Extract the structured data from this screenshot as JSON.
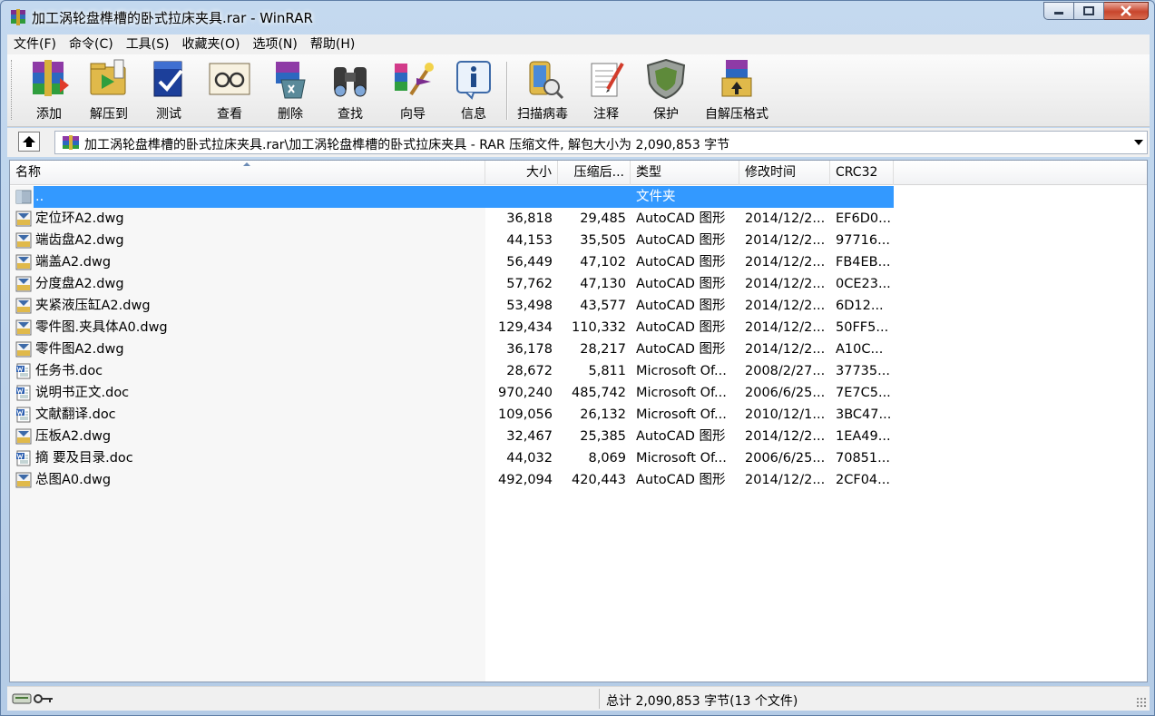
{
  "window": {
    "title": "加工涡轮盘榫槽的卧式拉床夹具.rar - WinRAR"
  },
  "menu": [
    {
      "label": "文件(F)"
    },
    {
      "label": "命令(C)"
    },
    {
      "label": "工具(S)"
    },
    {
      "label": "收藏夹(O)"
    },
    {
      "label": "选项(N)"
    },
    {
      "label": "帮助(H)"
    }
  ],
  "toolbar": [
    {
      "label": "添加",
      "icon": "add-archive-icon"
    },
    {
      "label": "解压到",
      "icon": "extract-to-icon"
    },
    {
      "label": "测试",
      "icon": "test-icon"
    },
    {
      "label": "查看",
      "icon": "view-icon"
    },
    {
      "label": "删除",
      "icon": "delete-icon"
    },
    {
      "label": "查找",
      "icon": "find-icon"
    },
    {
      "label": "向导",
      "icon": "wizard-icon"
    },
    {
      "label": "信息",
      "icon": "info-icon"
    },
    {
      "label": "扫描病毒",
      "icon": "virus-scan-icon"
    },
    {
      "label": "注释",
      "icon": "comment-icon"
    },
    {
      "label": "保护",
      "icon": "protect-icon"
    },
    {
      "label": "自解压格式",
      "icon": "sfx-icon"
    }
  ],
  "address": {
    "path": "加工涡轮盘榫槽的卧式拉床夹具.rar\\加工涡轮盘榫槽的卧式拉床夹具 - RAR 压缩文件, 解包大小为 2,090,853 字节"
  },
  "columns": {
    "name": "名称",
    "size": "大小",
    "packed": "压缩后...",
    "type": "类型",
    "modified": "修改时间",
    "crc": "CRC32"
  },
  "files": [
    {
      "name": "..",
      "size": "",
      "packed": "",
      "type": "文件夹",
      "modified": "",
      "crc": "",
      "kind": "folder",
      "selected": true
    },
    {
      "name": "定位环A2.dwg",
      "size": "36,818",
      "packed": "29,485",
      "type": "AutoCAD 图形",
      "modified": "2014/12/2...",
      "crc": "EF6D0...",
      "kind": "dwg"
    },
    {
      "name": "端齿盘A2.dwg",
      "size": "44,153",
      "packed": "35,505",
      "type": "AutoCAD 图形",
      "modified": "2014/12/2...",
      "crc": "97716...",
      "kind": "dwg"
    },
    {
      "name": "端盖A2.dwg",
      "size": "56,449",
      "packed": "47,102",
      "type": "AutoCAD 图形",
      "modified": "2014/12/2...",
      "crc": "FB4EB...",
      "kind": "dwg"
    },
    {
      "name": "分度盘A2.dwg",
      "size": "57,762",
      "packed": "47,130",
      "type": "AutoCAD 图形",
      "modified": "2014/12/2...",
      "crc": "0CE23...",
      "kind": "dwg"
    },
    {
      "name": "夹紧液压缸A2.dwg",
      "size": "53,498",
      "packed": "43,577",
      "type": "AutoCAD 图形",
      "modified": "2014/12/2...",
      "crc": "6D12...",
      "kind": "dwg"
    },
    {
      "name": "零件图.夹具体A0.dwg",
      "size": "129,434",
      "packed": "110,332",
      "type": "AutoCAD 图形",
      "modified": "2014/12/2...",
      "crc": "50FF5...",
      "kind": "dwg"
    },
    {
      "name": "零件图A2.dwg",
      "size": "36,178",
      "packed": "28,217",
      "type": "AutoCAD 图形",
      "modified": "2014/12/2...",
      "crc": "A10C...",
      "kind": "dwg"
    },
    {
      "name": "任务书.doc",
      "size": "28,672",
      "packed": "5,811",
      "type": "Microsoft Of...",
      "modified": "2008/2/27...",
      "crc": "37735...",
      "kind": "doc"
    },
    {
      "name": "说明书正文.doc",
      "size": "970,240",
      "packed": "485,742",
      "type": "Microsoft Of...",
      "modified": "2006/6/25...",
      "crc": "7E7C5...",
      "kind": "doc"
    },
    {
      "name": "文献翻译.doc",
      "size": "109,056",
      "packed": "26,132",
      "type": "Microsoft Of...",
      "modified": "2010/12/1...",
      "crc": "3BC47...",
      "kind": "doc"
    },
    {
      "name": "压板A2.dwg",
      "size": "32,467",
      "packed": "25,385",
      "type": "AutoCAD 图形",
      "modified": "2014/12/2...",
      "crc": "1EA49...",
      "kind": "dwg"
    },
    {
      "name": "摘 要及目录.doc",
      "size": "44,032",
      "packed": "8,069",
      "type": "Microsoft Of...",
      "modified": "2006/6/25...",
      "crc": "70851...",
      "kind": "doc"
    },
    {
      "name": "总图A0.dwg",
      "size": "492,094",
      "packed": "420,443",
      "type": "AutoCAD 图形",
      "modified": "2014/12/2...",
      "crc": "2CF04...",
      "kind": "dwg"
    }
  ],
  "status": {
    "total": "总计 2,090,853 字节(13 个文件)"
  }
}
